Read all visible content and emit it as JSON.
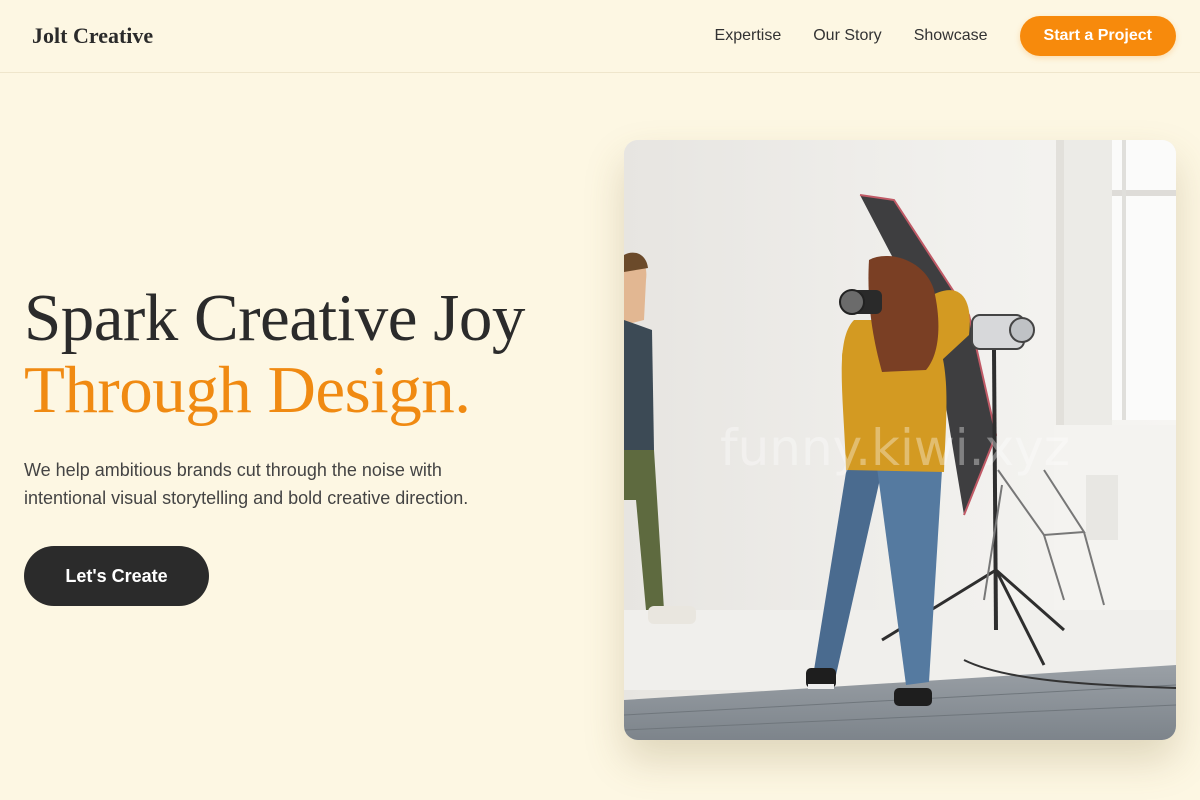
{
  "brand": {
    "name": "Jolt Creative"
  },
  "nav": {
    "links": [
      "Expertise",
      "Our Story",
      "Showcase"
    ],
    "cta_label": "Start a Project"
  },
  "hero": {
    "headline_line1": "Spark Creative Joy",
    "headline_line2": "Through Design.",
    "subtext": "We help ambitious brands cut through the noise with intentional visual storytelling and bold creative direction.",
    "button_label": "Let's Create"
  },
  "image": {
    "description": "Photographer in studio",
    "watermark": "funny.kiwi.xyz"
  },
  "colors": {
    "background": "#fdf7e3",
    "accent": "#f78a0c",
    "dark": "#2b2b2b"
  }
}
